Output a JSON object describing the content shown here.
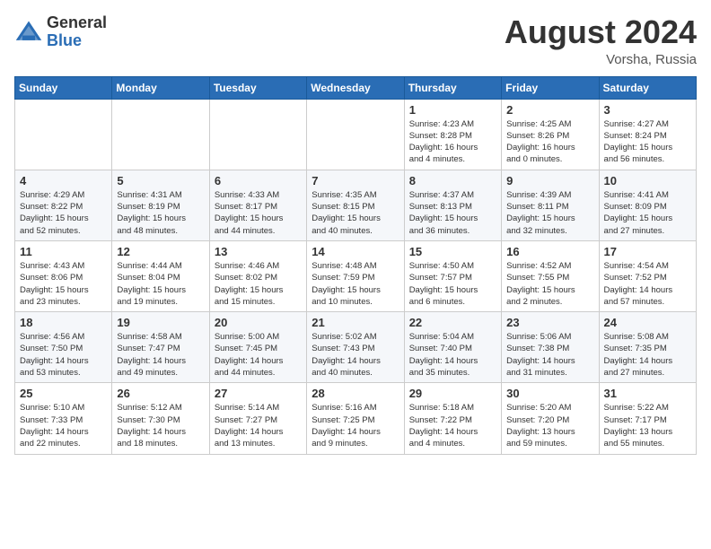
{
  "header": {
    "logo_general": "General",
    "logo_blue": "Blue",
    "month_title": "August 2024",
    "location": "Vorsha, Russia"
  },
  "days_of_week": [
    "Sunday",
    "Monday",
    "Tuesday",
    "Wednesday",
    "Thursday",
    "Friday",
    "Saturday"
  ],
  "weeks": [
    [
      {
        "num": "",
        "info": ""
      },
      {
        "num": "",
        "info": ""
      },
      {
        "num": "",
        "info": ""
      },
      {
        "num": "",
        "info": ""
      },
      {
        "num": "1",
        "info": "Sunrise: 4:23 AM\nSunset: 8:28 PM\nDaylight: 16 hours\nand 4 minutes."
      },
      {
        "num": "2",
        "info": "Sunrise: 4:25 AM\nSunset: 8:26 PM\nDaylight: 16 hours\nand 0 minutes."
      },
      {
        "num": "3",
        "info": "Sunrise: 4:27 AM\nSunset: 8:24 PM\nDaylight: 15 hours\nand 56 minutes."
      }
    ],
    [
      {
        "num": "4",
        "info": "Sunrise: 4:29 AM\nSunset: 8:22 PM\nDaylight: 15 hours\nand 52 minutes."
      },
      {
        "num": "5",
        "info": "Sunrise: 4:31 AM\nSunset: 8:19 PM\nDaylight: 15 hours\nand 48 minutes."
      },
      {
        "num": "6",
        "info": "Sunrise: 4:33 AM\nSunset: 8:17 PM\nDaylight: 15 hours\nand 44 minutes."
      },
      {
        "num": "7",
        "info": "Sunrise: 4:35 AM\nSunset: 8:15 PM\nDaylight: 15 hours\nand 40 minutes."
      },
      {
        "num": "8",
        "info": "Sunrise: 4:37 AM\nSunset: 8:13 PM\nDaylight: 15 hours\nand 36 minutes."
      },
      {
        "num": "9",
        "info": "Sunrise: 4:39 AM\nSunset: 8:11 PM\nDaylight: 15 hours\nand 32 minutes."
      },
      {
        "num": "10",
        "info": "Sunrise: 4:41 AM\nSunset: 8:09 PM\nDaylight: 15 hours\nand 27 minutes."
      }
    ],
    [
      {
        "num": "11",
        "info": "Sunrise: 4:43 AM\nSunset: 8:06 PM\nDaylight: 15 hours\nand 23 minutes."
      },
      {
        "num": "12",
        "info": "Sunrise: 4:44 AM\nSunset: 8:04 PM\nDaylight: 15 hours\nand 19 minutes."
      },
      {
        "num": "13",
        "info": "Sunrise: 4:46 AM\nSunset: 8:02 PM\nDaylight: 15 hours\nand 15 minutes."
      },
      {
        "num": "14",
        "info": "Sunrise: 4:48 AM\nSunset: 7:59 PM\nDaylight: 15 hours\nand 10 minutes."
      },
      {
        "num": "15",
        "info": "Sunrise: 4:50 AM\nSunset: 7:57 PM\nDaylight: 15 hours\nand 6 minutes."
      },
      {
        "num": "16",
        "info": "Sunrise: 4:52 AM\nSunset: 7:55 PM\nDaylight: 15 hours\nand 2 minutes."
      },
      {
        "num": "17",
        "info": "Sunrise: 4:54 AM\nSunset: 7:52 PM\nDaylight: 14 hours\nand 57 minutes."
      }
    ],
    [
      {
        "num": "18",
        "info": "Sunrise: 4:56 AM\nSunset: 7:50 PM\nDaylight: 14 hours\nand 53 minutes."
      },
      {
        "num": "19",
        "info": "Sunrise: 4:58 AM\nSunset: 7:47 PM\nDaylight: 14 hours\nand 49 minutes."
      },
      {
        "num": "20",
        "info": "Sunrise: 5:00 AM\nSunset: 7:45 PM\nDaylight: 14 hours\nand 44 minutes."
      },
      {
        "num": "21",
        "info": "Sunrise: 5:02 AM\nSunset: 7:43 PM\nDaylight: 14 hours\nand 40 minutes."
      },
      {
        "num": "22",
        "info": "Sunrise: 5:04 AM\nSunset: 7:40 PM\nDaylight: 14 hours\nand 35 minutes."
      },
      {
        "num": "23",
        "info": "Sunrise: 5:06 AM\nSunset: 7:38 PM\nDaylight: 14 hours\nand 31 minutes."
      },
      {
        "num": "24",
        "info": "Sunrise: 5:08 AM\nSunset: 7:35 PM\nDaylight: 14 hours\nand 27 minutes."
      }
    ],
    [
      {
        "num": "25",
        "info": "Sunrise: 5:10 AM\nSunset: 7:33 PM\nDaylight: 14 hours\nand 22 minutes."
      },
      {
        "num": "26",
        "info": "Sunrise: 5:12 AM\nSunset: 7:30 PM\nDaylight: 14 hours\nand 18 minutes."
      },
      {
        "num": "27",
        "info": "Sunrise: 5:14 AM\nSunset: 7:27 PM\nDaylight: 14 hours\nand 13 minutes."
      },
      {
        "num": "28",
        "info": "Sunrise: 5:16 AM\nSunset: 7:25 PM\nDaylight: 14 hours\nand 9 minutes."
      },
      {
        "num": "29",
        "info": "Sunrise: 5:18 AM\nSunset: 7:22 PM\nDaylight: 14 hours\nand 4 minutes."
      },
      {
        "num": "30",
        "info": "Sunrise: 5:20 AM\nSunset: 7:20 PM\nDaylight: 13 hours\nand 59 minutes."
      },
      {
        "num": "31",
        "info": "Sunrise: 5:22 AM\nSunset: 7:17 PM\nDaylight: 13 hours\nand 55 minutes."
      }
    ]
  ]
}
